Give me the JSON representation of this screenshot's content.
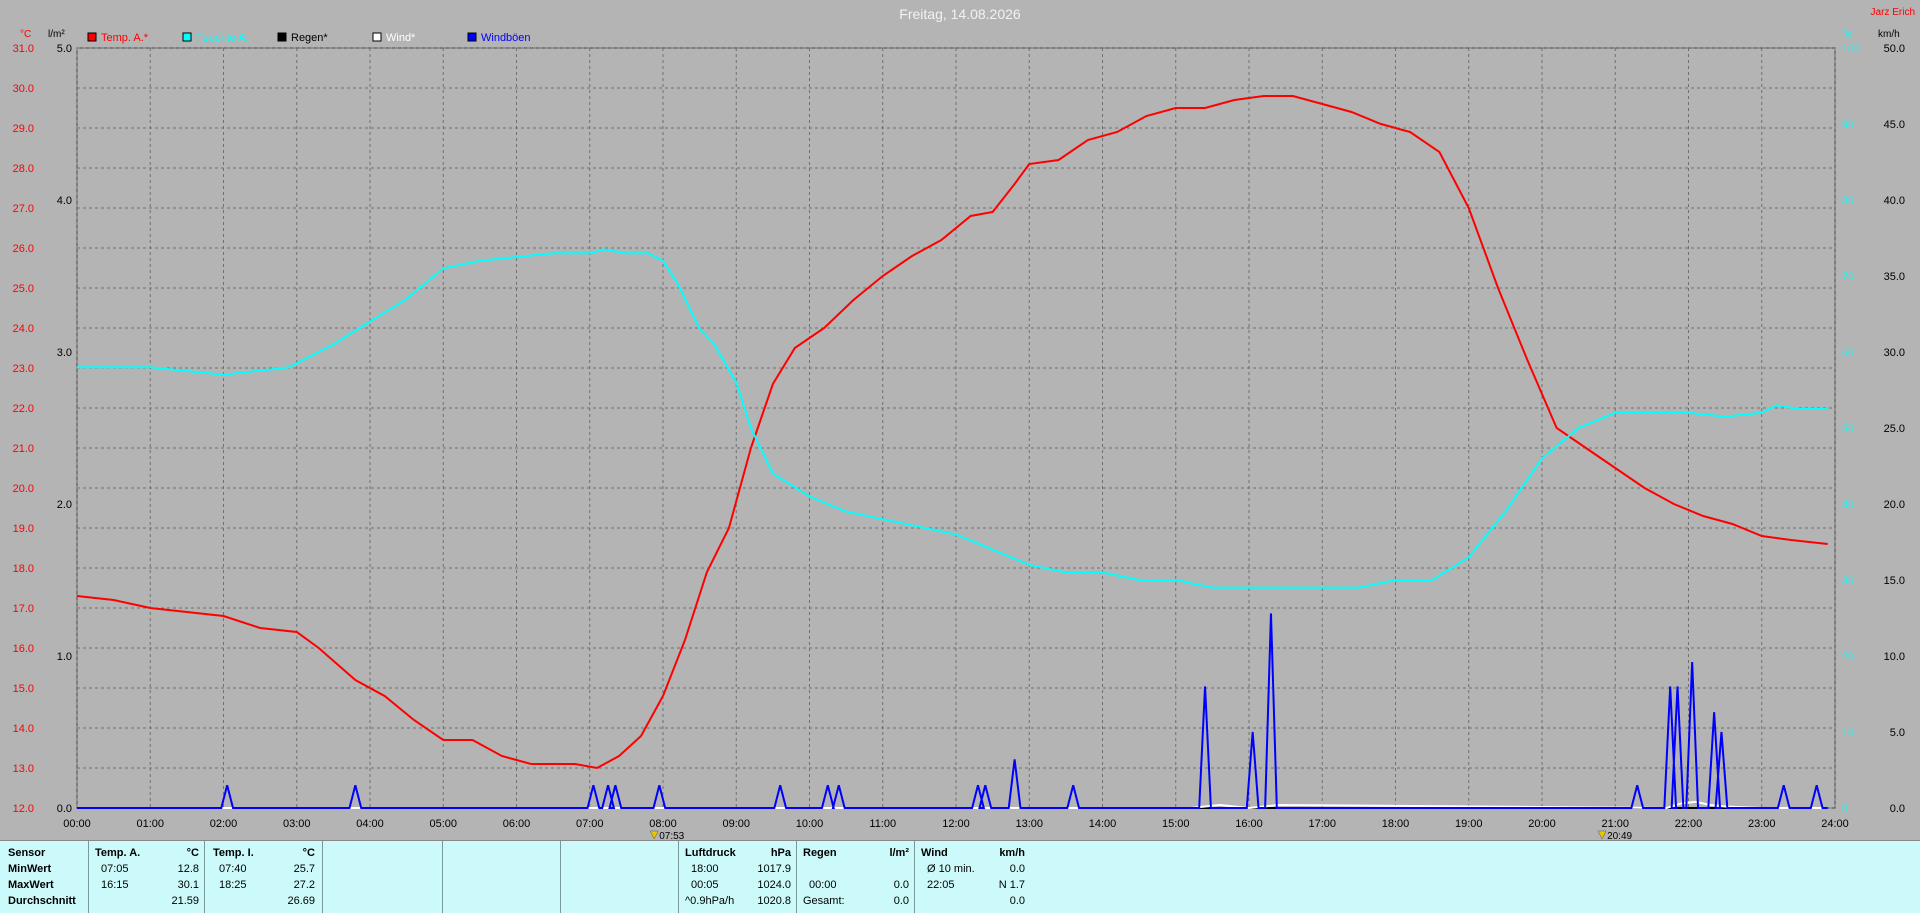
{
  "chart_data": {
    "type": "line",
    "title": "Freitag, 14.08.2026",
    "corner_label": "Jarz Erich",
    "legend_placement": "top-left",
    "grid": true,
    "axes": {
      "left_temp": {
        "unit": "°C",
        "ylim": [
          12.0,
          31.0
        ],
        "ticks": [
          "12.0",
          "13.0",
          "14.0",
          "15.0",
          "16.0",
          "17.0",
          "18.0",
          "19.0",
          "20.0",
          "21.0",
          "22.0",
          "23.0",
          "24.0",
          "25.0",
          "26.0",
          "27.0",
          "28.0",
          "29.0",
          "30.0",
          "31.0"
        ]
      },
      "left_rain": {
        "unit": "l/m²",
        "ylim": [
          0.0,
          5.0
        ],
        "ticks": [
          "0.0",
          "1.0",
          "2.0",
          "3.0",
          "4.0",
          "5.0"
        ]
      },
      "right_humidity": {
        "unit": "%",
        "ylim": [
          0,
          100
        ],
        "ticks": [
          "0",
          "10",
          "20",
          "30",
          "40",
          "50",
          "60",
          "70",
          "80",
          "90",
          "100"
        ]
      },
      "right_wind": {
        "unit": "km/h",
        "ylim": [
          0.0,
          50.0
        ],
        "ticks": [
          "0.0",
          "5.0",
          "10.0",
          "15.0",
          "20.0",
          "25.0",
          "30.0",
          "35.0",
          "40.0",
          "45.0",
          "50.0"
        ]
      },
      "x": {
        "range": [
          0,
          24
        ],
        "ticks": [
          "00:00",
          "01:00",
          "02:00",
          "03:00",
          "04:00",
          "05:00",
          "06:00",
          "07:00",
          "08:00",
          "09:00",
          "10:00",
          "11:00",
          "12:00",
          "13:00",
          "14:00",
          "15:00",
          "16:00",
          "17:00",
          "18:00",
          "19:00",
          "20:00",
          "21:00",
          "22:00",
          "23:00",
          "24:00"
        ]
      }
    },
    "markers": [
      {
        "x": 7.88,
        "label": "07:53"
      },
      {
        "x": 20.82,
        "label": "20:49"
      }
    ],
    "series": [
      {
        "name": "Temp. A.*",
        "color": "#ff0000",
        "axis": "left_temp",
        "x": [
          0,
          0.5,
          1,
          1.5,
          2,
          2.5,
          3,
          3.3,
          3.8,
          4.2,
          4.6,
          5.0,
          5.4,
          5.8,
          6.2,
          6.8,
          7.1,
          7.4,
          7.7,
          8.0,
          8.3,
          8.6,
          8.9,
          9.2,
          9.5,
          9.8,
          10.2,
          10.6,
          11.0,
          11.4,
          11.8,
          12.2,
          12.5,
          12.8,
          13.0,
          13.4,
          13.8,
          14.2,
          14.6,
          15.0,
          15.4,
          15.8,
          16.2,
          16.6,
          17.0,
          17.4,
          17.8,
          18.2,
          18.6,
          19.0,
          19.4,
          19.8,
          20.2,
          20.6,
          21.0,
          21.4,
          21.8,
          22.2,
          22.6,
          23.0,
          23.4,
          23.9
        ],
        "values": [
          17.3,
          17.2,
          17.0,
          16.9,
          16.8,
          16.5,
          16.4,
          16.0,
          15.2,
          14.8,
          14.2,
          13.7,
          13.7,
          13.3,
          13.1,
          13.1,
          13.0,
          13.3,
          13.8,
          14.8,
          16.2,
          17.9,
          19.0,
          21.0,
          22.6,
          23.5,
          24.0,
          24.7,
          25.3,
          25.8,
          26.2,
          26.8,
          26.9,
          27.6,
          28.1,
          28.2,
          28.7,
          28.9,
          29.3,
          29.5,
          29.5,
          29.7,
          29.8,
          29.8,
          29.6,
          29.4,
          29.1,
          28.9,
          28.4,
          27.0,
          25.0,
          23.2,
          21.5,
          21.0,
          20.5,
          20.0,
          19.6,
          19.3,
          19.1,
          18.8,
          18.7,
          18.6
        ]
      },
      {
        "name": "Feuchte A.",
        "color": "#00ffff",
        "axis": "right_humidity",
        "x": [
          0,
          1,
          2,
          2.9,
          3.5,
          4.0,
          4.5,
          5.0,
          5.5,
          6.0,
          6.5,
          7.0,
          7.2,
          7.5,
          7.8,
          8.0,
          8.2,
          8.5,
          8.7,
          9.0,
          9.2,
          9.5,
          10.0,
          10.5,
          11.0,
          11.5,
          12.0,
          12.5,
          13.0,
          13.5,
          14.0,
          14.5,
          15.0,
          15.5,
          16.0,
          16.5,
          17.0,
          17.5,
          18.0,
          18.5,
          19.0,
          19.5,
          20.0,
          20.5,
          21.0,
          21.5,
          22.0,
          22.5,
          23.0,
          23.2,
          23.5,
          23.9
        ],
        "values": [
          58,
          58,
          57,
          58,
          61,
          64,
          67,
          71,
          72,
          72.5,
          73,
          73,
          73.5,
          73,
          73,
          72,
          69,
          63,
          61,
          56,
          50,
          44,
          41,
          39,
          38,
          37,
          36,
          34,
          32,
          31,
          31,
          30,
          30,
          29,
          29,
          29,
          29,
          29,
          30,
          30,
          33,
          39,
          46,
          50,
          52,
          52,
          52,
          51.5,
          52,
          53,
          52.5,
          52.5
        ]
      },
      {
        "name": "Regen*",
        "color": "#000000",
        "axis": "left_rain",
        "x": [
          0,
          23.9
        ],
        "values": [
          0.0,
          0.0
        ]
      },
      {
        "name": "Wind*",
        "color": "#ffffff",
        "axis": "right_wind",
        "x": [
          0,
          15.2,
          15.6,
          16.0,
          16.4,
          21.7,
          21.9,
          22.1,
          22.3,
          22.5,
          23.0,
          23.9
        ],
        "values": [
          0,
          0,
          0.2,
          0,
          0.2,
          0,
          0.3,
          0.4,
          0.2,
          0.1,
          0,
          0
        ]
      },
      {
        "name": "Windböen",
        "color": "#0000ff",
        "axis": "right_wind",
        "spikes": [
          {
            "x": 2.05,
            "v": 1.5
          },
          {
            "x": 3.8,
            "v": 1.5
          },
          {
            "x": 7.05,
            "v": 1.5
          },
          {
            "x": 7.25,
            "v": 1.5
          },
          {
            "x": 7.35,
            "v": 1.5
          },
          {
            "x": 7.95,
            "v": 1.5
          },
          {
            "x": 9.6,
            "v": 1.5
          },
          {
            "x": 10.25,
            "v": 1.5
          },
          {
            "x": 10.4,
            "v": 1.5
          },
          {
            "x": 12.3,
            "v": 1.5
          },
          {
            "x": 12.4,
            "v": 1.5
          },
          {
            "x": 12.8,
            "v": 3.2
          },
          {
            "x": 13.6,
            "v": 1.5
          },
          {
            "x": 15.4,
            "v": 8.0
          },
          {
            "x": 16.05,
            "v": 5.0
          },
          {
            "x": 16.3,
            "v": 12.8
          },
          {
            "x": 21.3,
            "v": 1.5
          },
          {
            "x": 21.75,
            "v": 8.0
          },
          {
            "x": 21.85,
            "v": 8.0
          },
          {
            "x": 22.05,
            "v": 9.6
          },
          {
            "x": 22.35,
            "v": 6.3
          },
          {
            "x": 22.45,
            "v": 5.0
          },
          {
            "x": 23.3,
            "v": 1.5
          },
          {
            "x": 23.75,
            "v": 1.5
          }
        ]
      }
    ]
  },
  "stats": {
    "sensor": {
      "label": "Sensor",
      "rows": [
        "MinWert",
        "MaxWert",
        "Durchschnitt"
      ]
    },
    "temp_a": {
      "label": "Temp. A.",
      "unit": "°C",
      "min_time": "07:05",
      "min": "12.8",
      "max_time": "16:15",
      "max": "30.1",
      "avg": "21.59"
    },
    "temp_i": {
      "label": "Temp. I.",
      "unit": "°C",
      "min_time": "07:40",
      "min": "25.7",
      "max_time": "18:25",
      "max": "27.2",
      "avg": "26.69"
    },
    "pressure": {
      "label": "Luftdruck",
      "unit": "hPa",
      "min_time": "18:00",
      "min": "1017.9",
      "max_time": "00:05",
      "max": "1024.0",
      "trend_label": "^0.9hPa/h",
      "avg": "1020.8"
    },
    "rain": {
      "label": "Regen",
      "unit": "l/m²",
      "r1_label": "",
      "r1": "",
      "r2_label": "00:00",
      "r2": "0.0",
      "r3_label": "Gesamt:",
      "r3": "0.0"
    },
    "wind": {
      "label": "Wind",
      "unit": "km/h",
      "r1_label": "Ø 10 min.",
      "r1": "0.0",
      "r2_label": "22:05",
      "r2": "N 1.7",
      "r3": "0.0"
    }
  }
}
